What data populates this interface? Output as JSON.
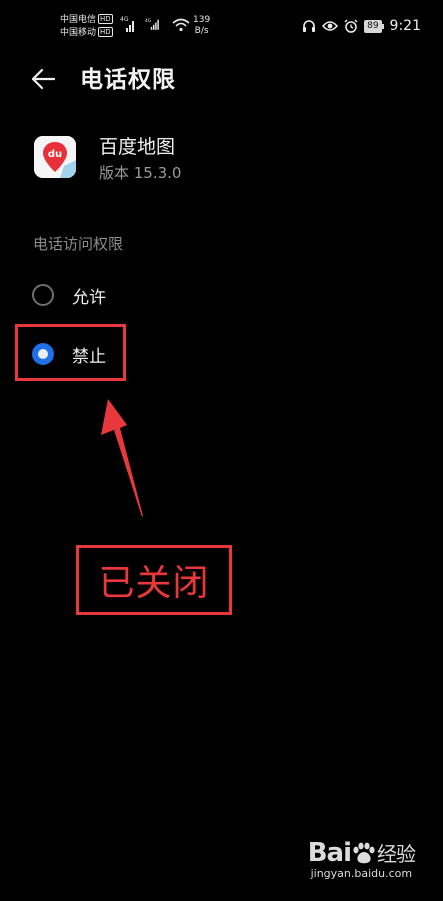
{
  "status_bar": {
    "carrier1": "中国电信",
    "carrier2": "中国移动",
    "hd_badge": "HD",
    "network_4g": "4G",
    "speed_value": "139",
    "speed_unit": "B/s",
    "battery": "89",
    "time": "9:21",
    "icons": [
      "headset-icon",
      "eye-icon",
      "alarm-icon",
      "battery-icon"
    ]
  },
  "header": {
    "title": "电话权限",
    "back_icon": "arrow-left-icon"
  },
  "app": {
    "name": "百度地图",
    "version": "版本 15.3.0",
    "icon_text": "du",
    "icon_color": "#e8303a"
  },
  "permission": {
    "section_title": "电话访问权限",
    "options": [
      {
        "label": "允许",
        "selected": false
      },
      {
        "label": "禁止",
        "selected": true
      }
    ]
  },
  "annotation": {
    "text": "已关闭",
    "color": "#e8383b"
  },
  "watermark": {
    "logo": "Bai",
    "logo_suffix": "经验",
    "url": "jingyan.baidu.com"
  }
}
